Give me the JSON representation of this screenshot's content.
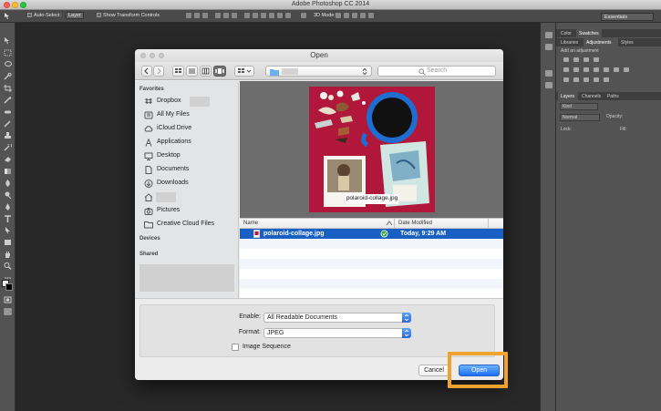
{
  "app": {
    "title": "Adobe Photoshop CC 2014"
  },
  "options_bar": {
    "auto_select_label": "Auto-Select:",
    "auto_select_value": "Layer",
    "transform_label": "Show Transform Controls",
    "mode_label": "3D Mode:",
    "workspace": "Essentials"
  },
  "panels": {
    "color_tabs": [
      "Color",
      "Swatches"
    ],
    "adjust_tabs": [
      "Libraries",
      "Adjustments",
      "Styles"
    ],
    "add_adjustment": "Add an adjustment",
    "layers_tabs": [
      "Layers",
      "Channels",
      "Paths"
    ],
    "kind_placeholder": "Kind",
    "blend_mode": "Normal",
    "opacity_label": "Opacity:",
    "lock_label": "Lock:",
    "fill_label": "Fill:"
  },
  "dialog": {
    "title": "Open",
    "location": "",
    "search_placeholder": "Search",
    "sidebar": {
      "favorites_heading": "Favorites",
      "favorites": [
        {
          "label": "Dropbox",
          "icon": "dropbox-icon"
        },
        {
          "label": "All My Files",
          "icon": "all-files-icon"
        },
        {
          "label": "iCloud Drive",
          "icon": "cloud-icon"
        },
        {
          "label": "Applications",
          "icon": "applications-icon"
        },
        {
          "label": "Desktop",
          "icon": "desktop-icon"
        },
        {
          "label": "Documents",
          "icon": "documents-icon"
        },
        {
          "label": "Downloads",
          "icon": "downloads-icon"
        },
        {
          "label": "",
          "icon": "home-icon"
        },
        {
          "label": "Pictures",
          "icon": "camera-icon"
        },
        {
          "label": "Creative Cloud Files",
          "icon": "folder-icon"
        }
      ],
      "devices_heading": "Devices",
      "shared_heading": "Shared"
    },
    "preview_caption": "polaroid-collage.jpg",
    "file_list": {
      "columns": [
        "Name",
        "Date Modified"
      ],
      "rows": [
        {
          "name": "polaroid-collage.jpg",
          "date": "Today, 9:29 AM"
        }
      ]
    },
    "enable_label": "Enable:",
    "enable_value": "All Readable Documents",
    "format_label": "Format:",
    "format_value": "JPEG",
    "image_sequence_label": "Image Sequence",
    "cancel_label": "Cancel",
    "open_label": "Open"
  },
  "colors": {
    "accent_blue": "#1960c5",
    "highlight_orange": "#f0a32c",
    "preview_background": "#b0173a"
  }
}
